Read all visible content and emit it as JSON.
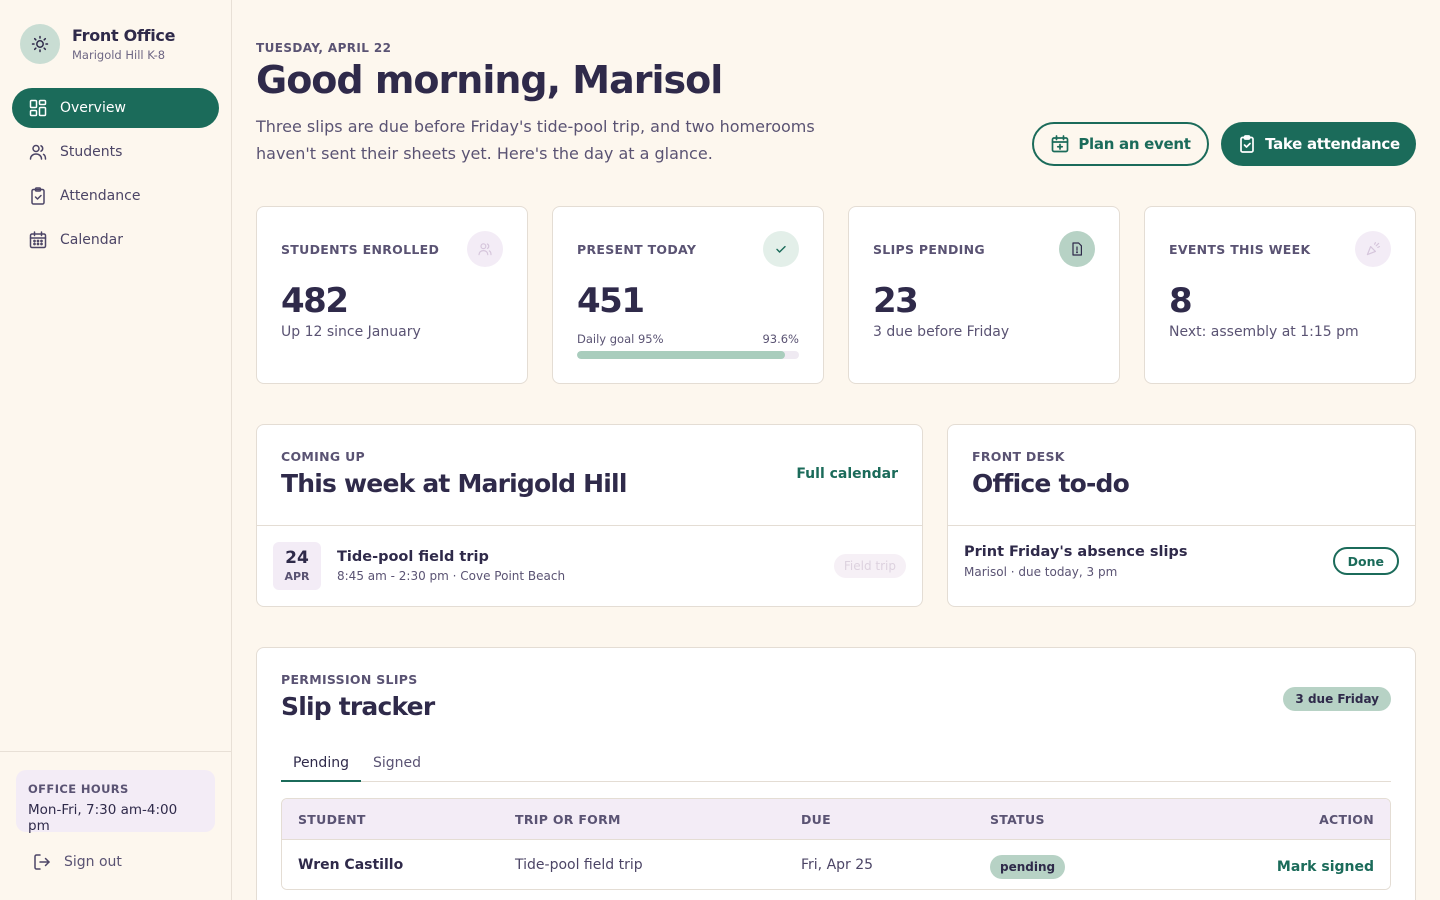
{
  "brand": {
    "name": "Front Office",
    "school": "Marigold Hill K-8"
  },
  "nav": {
    "items": [
      {
        "label": "Overview",
        "icon": "grid-icon"
      },
      {
        "label": "Students",
        "icon": "users-icon"
      },
      {
        "label": "Attendance",
        "icon": "clipboard-check-icon"
      },
      {
        "label": "Calendar",
        "icon": "calendar-icon"
      }
    ]
  },
  "office_hours": {
    "label": "OFFICE HOURS",
    "value": "Mon-Fri, 7:30 am-4:00 pm"
  },
  "signout": {
    "label": "Sign out"
  },
  "header": {
    "date": "TUESDAY, APRIL 22",
    "greeting": "Good morning, Marisol",
    "intro": "Three slips are due before Friday's tide-pool trip, and two homerooms haven't sent their sheets yet. Here's the day at a glance.",
    "plan_label": "Plan an event",
    "attendance_label": "Take attendance"
  },
  "stats": [
    {
      "label": "STUDENTS ENROLLED",
      "value": "482",
      "sub": "Up 12 since January",
      "icon": "users-icon"
    },
    {
      "label": "PRESENT TODAY",
      "value": "451",
      "goal_label": "Daily goal 95%",
      "percent_label": "93.6%",
      "progress": 0.936,
      "icon": "check-icon"
    },
    {
      "label": "SLIPS PENDING",
      "value": "23",
      "sub": "3 due before Friday",
      "icon": "document-alert-icon"
    },
    {
      "label": "EVENTS THIS WEEK",
      "value": "8",
      "sub": "Next: assembly at 1:15 pm",
      "icon": "party-icon"
    }
  ],
  "coming_up": {
    "eyebrow": "COMING UP",
    "title": "This week at Marigold Hill",
    "link": "Full calendar",
    "events": [
      {
        "day": "24",
        "month": "APR",
        "title": "Tide-pool field trip",
        "meta": "8:45 am - 2:30 pm · Cove Point Beach",
        "tag": "Field trip"
      }
    ]
  },
  "todo": {
    "eyebrow": "FRONT DESK",
    "title": "Office to-do",
    "items": [
      {
        "title": "Print Friday's absence slips",
        "meta": "Marisol · due today, 3 pm",
        "action": "Done"
      }
    ]
  },
  "slips": {
    "eyebrow": "PERMISSION SLIPS",
    "title": "Slip tracker",
    "badge": "3 due Friday",
    "tabs": [
      "Pending",
      "Signed"
    ],
    "columns": [
      "STUDENT",
      "TRIP OR FORM",
      "DUE",
      "STATUS",
      "ACTION"
    ],
    "rows": [
      {
        "student": "Wren Castillo",
        "form": "Tide-pool field trip",
        "due": "Fri, Apr 25",
        "status": "pending",
        "action": "Mark signed"
      }
    ]
  },
  "colors": {
    "accent": "#1b6b5a",
    "background": "#fdf7ee",
    "ink": "#2f2a4a",
    "lavender": "#f3ecf6",
    "mint": "#b7d2c5"
  }
}
